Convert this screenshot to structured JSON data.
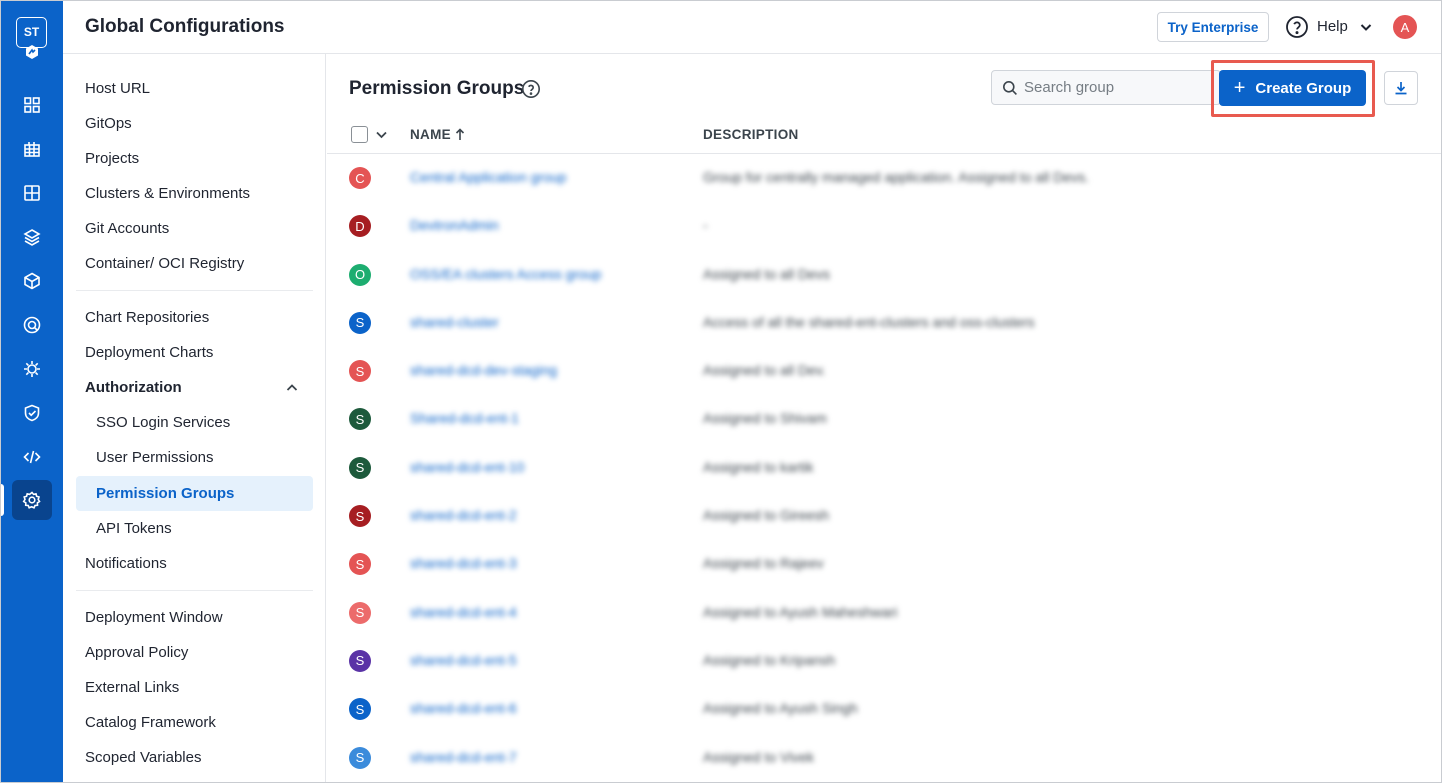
{
  "app": {
    "logo_text": "ST",
    "title": "Global Configurations",
    "try_enterprise_label": "Try Enterprise",
    "help_label": "Help",
    "user_avatar_initial": "A",
    "brand_color": "#0b63c9"
  },
  "rail": {
    "icons": [
      "grid-icon",
      "apps-icon",
      "dashboard-icon",
      "stack-icon",
      "cube-icon",
      "security-scan-icon",
      "bug-icon",
      "shield-check-icon",
      "code-icon",
      "settings-icon"
    ],
    "active": "settings-icon"
  },
  "settings_nav": {
    "items": [
      {
        "label": "Host URL"
      },
      {
        "label": "GitOps"
      },
      {
        "label": "Projects"
      },
      {
        "label": "Clusters & Environments"
      },
      {
        "label": "Git Accounts"
      },
      {
        "label": "Container/ OCI Registry"
      },
      {
        "label": "Chart Repositories"
      },
      {
        "label": "Deployment Charts"
      },
      {
        "label": "Authorization"
      },
      {
        "label": "SSO Login Services"
      },
      {
        "label": "User Permissions"
      },
      {
        "label": "Permission Groups"
      },
      {
        "label": "API Tokens"
      },
      {
        "label": "Notifications"
      },
      {
        "label": "Deployment Window"
      },
      {
        "label": "Approval Policy"
      },
      {
        "label": "External Links"
      },
      {
        "label": "Catalog Framework"
      },
      {
        "label": "Scoped Variables"
      }
    ],
    "active": "Permission Groups"
  },
  "main": {
    "page_title": "Permission Groups",
    "search_placeholder": "Search group",
    "create_button_label": "Create Group",
    "columns": {
      "name": "NAME",
      "description": "DESCRIPTION"
    },
    "rows": [
      {
        "initial": "C",
        "color": "#e45454",
        "name": "Central Application group",
        "description": "Group for centrally managed application. Assigned to all Devs."
      },
      {
        "initial": "D",
        "color": "#a61e22",
        "name": "DevtronAdmin",
        "description": "-"
      },
      {
        "initial": "O",
        "color": "#1dad70",
        "name": "OSS/EA clusters Access group",
        "description": "Assigned to all Devs"
      },
      {
        "initial": "S",
        "color": "#0b63c9",
        "name": "shared-cluster",
        "description": "Access of all the shared-ent-clusters and oss-clusters"
      },
      {
        "initial": "S",
        "color": "#e45454",
        "name": "shared-dcd-dev-staging",
        "description": "Assigned to all Dev."
      },
      {
        "initial": "S",
        "color": "#1d5a3c",
        "name": "Shared-dcd-ent-1",
        "description": "Assigned to Shivam"
      },
      {
        "initial": "S",
        "color": "#1d5a3c",
        "name": "shared-dcd-ent-10",
        "description": "Assigned to kartik"
      },
      {
        "initial": "S",
        "color": "#a61e22",
        "name": "shared-dcd-ent-2",
        "description": "Assigned to Gireesh"
      },
      {
        "initial": "S",
        "color": "#e45454",
        "name": "shared-dcd-ent-3",
        "description": "Assigned to Rajeev"
      },
      {
        "initial": "S",
        "color": "#ec6b6b",
        "name": "shared-dcd-ent-4",
        "description": "Assigned to Ayush Maheshwari"
      },
      {
        "initial": "S",
        "color": "#5a33a6",
        "name": "shared-dcd-ent-5",
        "description": "Assigned to Kripansh"
      },
      {
        "initial": "S",
        "color": "#0b63c9",
        "name": "shared-dcd-ent-6",
        "description": "Assigned to Ayush Singh"
      },
      {
        "initial": "S",
        "color": "#3b8bdb",
        "name": "shared-dcd-ent-7",
        "description": "Assigned to Vivek"
      }
    ]
  }
}
